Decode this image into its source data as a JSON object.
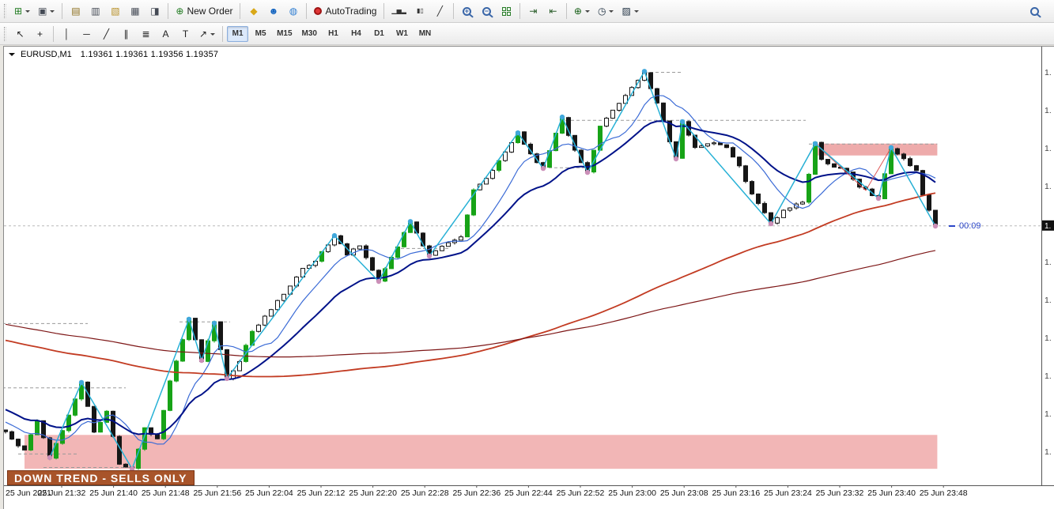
{
  "toolbar_main": {
    "groups": [
      {
        "buttons": [
          {
            "name": "new-chart",
            "glyph": "⊞",
            "color": "#1f7a1f",
            "dropdown": true
          },
          {
            "name": "profiles",
            "glyph": "▣",
            "color": "#444a55",
            "dropdown": true
          }
        ]
      },
      {
        "buttons": [
          {
            "name": "market-watch",
            "glyph": "▤",
            "color": "#8a6d1a"
          },
          {
            "name": "data-window",
            "glyph": "▥",
            "color": "#444a55"
          },
          {
            "name": "navigator",
            "glyph": "▧",
            "color": "#b8912a"
          },
          {
            "name": "terminal",
            "glyph": "▦",
            "color": "#444a55"
          },
          {
            "name": "strategy-tester",
            "glyph": "◨",
            "color": "#444a55"
          }
        ]
      },
      {
        "buttons": [
          {
            "name": "new-order",
            "glyph": "⊕",
            "color": "#1f7a1f",
            "label": "New Order"
          }
        ]
      },
      {
        "buttons": [
          {
            "name": "expert-advisors",
            "glyph": "◆",
            "color": "#d9a818"
          },
          {
            "name": "community",
            "glyph": "☻",
            "color": "#1565c0"
          },
          {
            "name": "web",
            "glyph": "◍",
            "color": "#2e7dd1"
          }
        ]
      },
      {
        "buttons": [
          {
            "name": "autotrading",
            "special": "dot",
            "label": "AutoTrading"
          }
        ]
      },
      {
        "buttons": [
          {
            "name": "bar-chart-mode",
            "glyph": "▁▅▂",
            "color": "#333333"
          },
          {
            "name": "candlestick-mode",
            "glyph": "▮▯",
            "color": "#333333"
          },
          {
            "name": "line-chart-mode",
            "glyph": "╱",
            "color": "#333333"
          }
        ]
      },
      {
        "buttons": [
          {
            "name": "zoom-in",
            "special": "mag",
            "sign": "+"
          },
          {
            "name": "zoom-out",
            "special": "mag",
            "sign": "−"
          },
          {
            "name": "tile-windows",
            "special": "tile"
          }
        ]
      },
      {
        "buttons": [
          {
            "name": "auto-scroll",
            "glyph": "⇥",
            "color": "#2a5d2a"
          },
          {
            "name": "chart-shift",
            "glyph": "⇤",
            "color": "#2a5d2a"
          }
        ]
      },
      {
        "buttons": [
          {
            "name": "indicators",
            "glyph": "⊕",
            "color": "#145c14",
            "dropdown": true
          },
          {
            "name": "periods",
            "glyph": "◷",
            "color": "#223344",
            "dropdown": true
          },
          {
            "name": "templates",
            "glyph": "▨",
            "color": "#223344",
            "dropdown": true
          }
        ]
      }
    ]
  },
  "toolbar_studies": {
    "groups": [
      {
        "buttons": [
          {
            "name": "cursor",
            "glyph": "↖",
            "color": "#222222"
          },
          {
            "name": "crosshair",
            "glyph": "+",
            "color": "#222222"
          }
        ]
      },
      {
        "buttons": [
          {
            "name": "vertical-line",
            "glyph": "│",
            "color": "#222222"
          },
          {
            "name": "horizontal-line",
            "glyph": "─",
            "color": "#222222"
          },
          {
            "name": "trendline",
            "glyph": "╱",
            "color": "#222222"
          },
          {
            "name": "equidistant-channel",
            "glyph": "∥",
            "color": "#222222"
          },
          {
            "name": "fibonacci",
            "glyph": "≣",
            "color": "#222222"
          },
          {
            "name": "text",
            "glyph": "A",
            "color": "#222222"
          },
          {
            "name": "text-label",
            "glyph": "T",
            "color": "#222222"
          },
          {
            "name": "shapes",
            "glyph": "↗",
            "color": "#222222",
            "dropdown": true
          }
        ]
      }
    ],
    "timeframes": {
      "active": "M1",
      "items": [
        "M1",
        "M5",
        "M15",
        "M30",
        "H1",
        "H4",
        "D1",
        "W1",
        "MN"
      ]
    }
  },
  "chart": {
    "symbol": "EURUSD,M1",
    "quotes": "1.19361 1.19361 1.19356 1.19357",
    "timer": "00:09",
    "trend_label": "DOWN TREND - SELLS ONLY",
    "price_axis_fragment": "1.",
    "x_labels": [
      "25 Jun 2021",
      "25 Jun 21:32",
      "25 Jun 21:40",
      "25 Jun 21:48",
      "25 Jun 21:56",
      "25 Jun 22:04",
      "25 Jun 22:12",
      "25 Jun 22:20",
      "25 Jun 22:28",
      "25 Jun 22:36",
      "25 Jun 22:44",
      "25 Jun 22:52",
      "25 Jun 23:00",
      "25 Jun 23:08",
      "25 Jun 23:16",
      "25 Jun 23:24",
      "25 Jun 23:32",
      "25 Jun 23:40",
      "25 Jun 23:48"
    ]
  },
  "chart_data": {
    "type": "candlestick",
    "symbol": "EURUSD",
    "period": "M1",
    "ohlc": {
      "open": 1.19361,
      "high": 1.19361,
      "low": 1.19356,
      "close": 1.19357
    },
    "price_path": [
      [
        0,
        1.18993
      ],
      [
        3,
        1.18958
      ],
      [
        5,
        1.19014
      ],
      [
        7,
        1.18947
      ],
      [
        10,
        1.19021
      ],
      [
        12,
        1.1908
      ],
      [
        14,
        1.18993
      ],
      [
        16,
        1.19028
      ],
      [
        18,
        1.18937
      ],
      [
        20,
        1.18927
      ],
      [
        22,
        1.19
      ],
      [
        24,
        1.18979
      ],
      [
        26,
        1.19084
      ],
      [
        29,
        1.19192
      ],
      [
        31,
        1.19119
      ],
      [
        33,
        1.19185
      ],
      [
        35,
        1.19087
      ],
      [
        37,
        1.19119
      ],
      [
        39,
        1.19168
      ],
      [
        42,
        1.1921
      ],
      [
        44,
        1.19238
      ],
      [
        47,
        1.1928
      ],
      [
        49,
        1.19294
      ],
      [
        52,
        1.1934
      ],
      [
        54,
        1.19308
      ],
      [
        56,
        1.19322
      ],
      [
        59,
        1.19259
      ],
      [
        62,
        1.19322
      ],
      [
        64,
        1.19365
      ],
      [
        67,
        1.19304
      ],
      [
        69,
        1.19322
      ],
      [
        72,
        1.19336
      ],
      [
        74,
        1.1942
      ],
      [
        77,
        1.19455
      ],
      [
        79,
        1.1949
      ],
      [
        81,
        1.19522
      ],
      [
        83,
        1.19483
      ],
      [
        85,
        1.19459
      ],
      [
        88,
        1.1955
      ],
      [
        90,
        1.1949
      ],
      [
        92,
        1.19452
      ],
      [
        94,
        1.19532
      ],
      [
        96,
        1.1956
      ],
      [
        98,
        1.19588
      ],
      [
        101,
        1.19631
      ],
      [
        103,
        1.19574
      ],
      [
        106,
        1.19476
      ],
      [
        107,
        1.19542
      ],
      [
        109,
        1.19497
      ],
      [
        112,
        1.19504
      ],
      [
        114,
        1.19497
      ],
      [
        116,
        1.19462
      ],
      [
        118,
        1.19413
      ],
      [
        121,
        1.19361
      ],
      [
        123,
        1.19385
      ],
      [
        126,
        1.19399
      ],
      [
        128,
        1.19503
      ],
      [
        129,
        1.19476
      ],
      [
        131,
        1.19462
      ],
      [
        133,
        1.19455
      ],
      [
        135,
        1.19427
      ],
      [
        137,
        1.19413
      ],
      [
        138,
        1.19406
      ],
      [
        140,
        1.19496
      ],
      [
        142,
        1.19476
      ],
      [
        144,
        1.19455
      ],
      [
        145,
        1.19413
      ],
      [
        147,
        1.19357
      ]
    ],
    "zigzag": [
      [
        7,
        1.18947,
        "l"
      ],
      [
        12,
        1.1908,
        "h"
      ],
      [
        20,
        1.18927,
        "l"
      ],
      [
        29,
        1.19192,
        "h"
      ],
      [
        31,
        1.19119,
        "l"
      ],
      [
        33,
        1.19185,
        "h"
      ],
      [
        35,
        1.19087,
        "l"
      ],
      [
        52,
        1.1934,
        "h"
      ],
      [
        59,
        1.19259,
        "l"
      ],
      [
        64,
        1.19365,
        "h"
      ],
      [
        67,
        1.19304,
        "l"
      ],
      [
        81,
        1.19522,
        "h"
      ],
      [
        85,
        1.19459,
        "l"
      ],
      [
        88,
        1.1955,
        "h"
      ],
      [
        92,
        1.19452,
        "l"
      ],
      [
        101,
        1.19631,
        "h"
      ],
      [
        106,
        1.19476,
        "l"
      ],
      [
        107,
        1.19542,
        "h"
      ],
      [
        121,
        1.19361,
        "l"
      ],
      [
        128,
        1.19503,
        "h"
      ],
      [
        138,
        1.19406,
        "l"
      ],
      [
        140,
        1.19496,
        "h"
      ],
      [
        147,
        1.19357,
        "l"
      ]
    ],
    "red_zigzag": [
      [
        [
          7,
          1.18947
        ],
        [
          12,
          1.1908
        ],
        [
          20,
          1.18927
        ]
      ],
      [
        [
          121,
          1.19361
        ],
        [
          128,
          1.19503
        ],
        [
          136,
          1.1942
        ],
        [
          140,
          1.19496
        ],
        [
          147,
          1.19357
        ]
      ]
    ],
    "levels": [
      [
        101,
        107,
        1.1963
      ],
      [
        88.5,
        126.5,
        1.19545
      ],
      [
        85,
        93,
        1.19461
      ],
      [
        62.5,
        70,
        1.19318
      ],
      [
        27.5,
        35.5,
        1.19188
      ],
      [
        -0.5,
        13,
        1.19185
      ],
      [
        -0.5,
        19,
        1.19071
      ],
      [
        2,
        11.5,
        1.18954
      ],
      [
        6,
        21,
        1.1893
      ]
    ],
    "current_price_level": 1.19358,
    "zones": [
      {
        "name": "demand-zone",
        "i1": 3,
        "i2": 147.3,
        "top": 1.18987,
        "bottom": 1.18927
      },
      {
        "name": "supply-zone",
        "i1": 128,
        "i2": 147.3,
        "top": 1.19503,
        "bottom": 1.19482
      }
    ],
    "moving_averages": [
      {
        "period": 9,
        "type": "sma",
        "color": "#3b6bd6",
        "width": 1.2
      },
      {
        "period": 20,
        "type": "ema",
        "color": "#001289",
        "width": 2
      },
      {
        "period": 110,
        "type": "sma",
        "color": "#c23b22",
        "width": 1.8
      },
      {
        "period": 150,
        "type": "sma",
        "color": "#7d1616",
        "width": 1.2
      }
    ],
    "colors": {
      "bull": "#ffffff",
      "bear": "#161616",
      "outline": "#161616",
      "strong_bull": "#17a317",
      "zigzag": "#27b1d6",
      "zigzag_red": "#df5757",
      "dot_high": "#41a8dc",
      "dot_low": "#cb8fb8",
      "zone": "#f2b6b6",
      "zone_top": "#eeabab",
      "level": "#9a9a9a",
      "timer": "#2b46c8",
      "trend_bg": "#a8542a",
      "trend_border": "#7a3314"
    }
  }
}
